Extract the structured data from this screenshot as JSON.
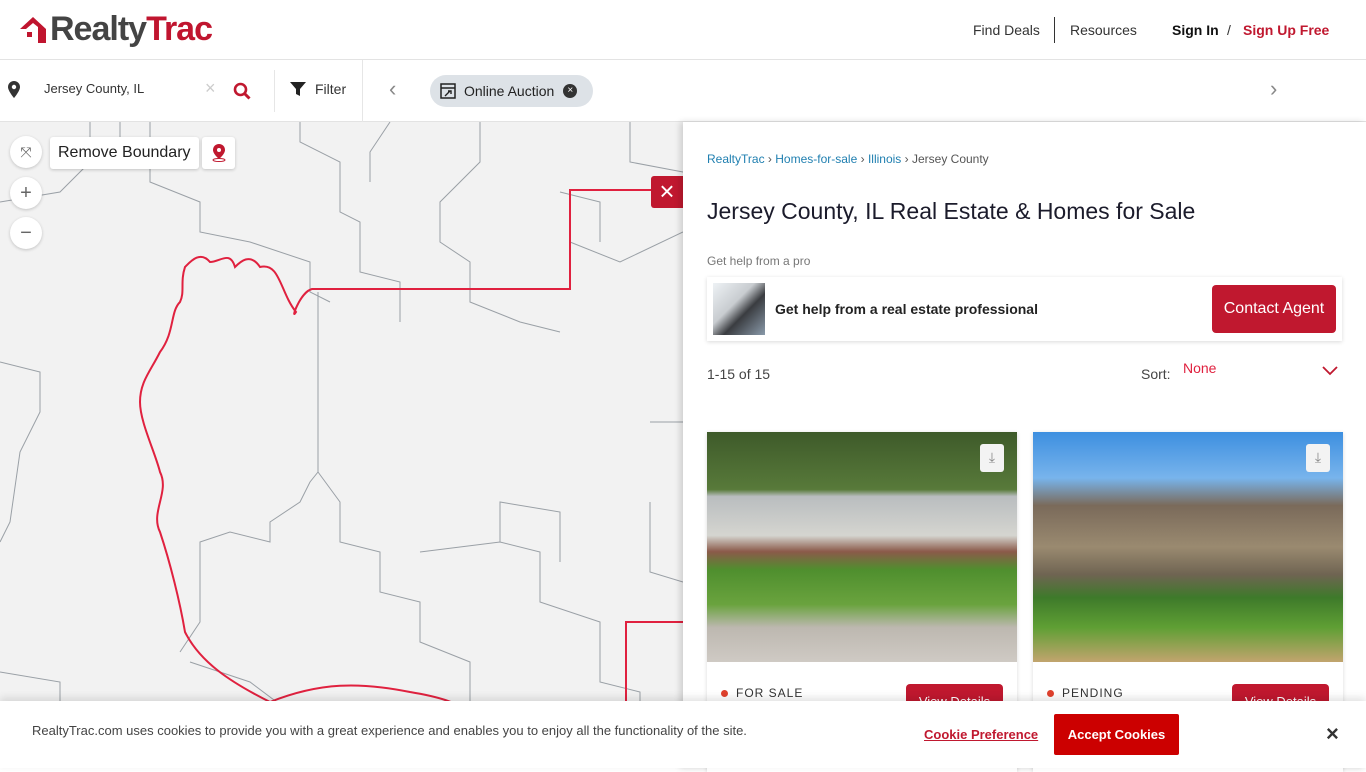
{
  "header": {
    "logo_text_a": "Realty",
    "logo_text_b": "Trac",
    "nav": [
      "Find Deals",
      "Resources"
    ],
    "sign_in": "Sign In",
    "divider": "/",
    "sign_up": "Sign Up Free"
  },
  "search": {
    "value": "Jersey County, IL",
    "filter_label": "Filter",
    "chip_label": "Online Auction"
  },
  "map": {
    "remove_boundary": "Remove Boundary",
    "zoom_in": "+",
    "zoom_out": "−",
    "boundary_color": "#e0213f"
  },
  "panel": {
    "breadcrumb": [
      "RealtyTrac",
      "Homes-for-sale",
      "Illinois",
      "Jersey County"
    ],
    "title": "Jersey County, IL Real Estate & Homes for Sale",
    "help_label": "Get help from a pro",
    "help_text": "Get help from a real estate professional",
    "contact_button": "Contact Agent",
    "count": "1-15 of 15",
    "sort_label": "Sort:",
    "sort_value": "None"
  },
  "listings": [
    {
      "status": "FOR SALE",
      "button": "View Details"
    },
    {
      "status": "PENDING",
      "button": "View Details"
    }
  ],
  "cookie": {
    "text": "RealtyTrac.com uses cookies to provide you with a great experience and enables you to enjoy all the functionality of the site.",
    "preference": "Cookie Preference",
    "accept": "Accept Cookies"
  },
  "colors": {
    "brand": "#c0182f",
    "link": "#1f7fb0"
  }
}
